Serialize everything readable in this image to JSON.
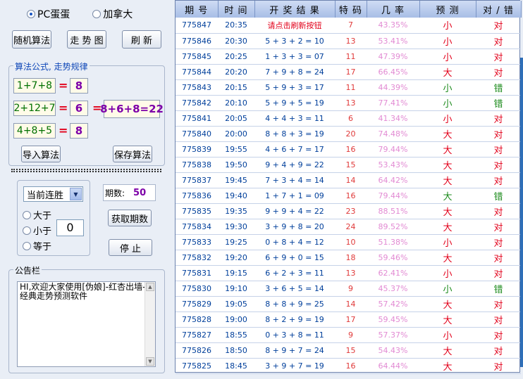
{
  "mode": {
    "options": [
      {
        "label": "PC蛋蛋",
        "selected": true
      },
      {
        "label": "加拿大",
        "selected": false
      }
    ]
  },
  "toolbar": {
    "random_label": "随机算法",
    "trend_label": "走 势 图",
    "refresh_label": "刷 新"
  },
  "formula_group": {
    "title": "算法公式, 走势规律",
    "formulas": [
      {
        "expr": "1+7+8",
        "eq": "=",
        "value": "8"
      },
      {
        "expr": "2+12+7",
        "eq": "=",
        "value": "6"
      },
      {
        "expr": "4+8+5",
        "eq": "=",
        "value": "8"
      }
    ],
    "total_eq": "=",
    "total": "8+6+8=22",
    "import_label": "导入算法",
    "save_label": "保存算法"
  },
  "filter": {
    "select_value": "当前连胜",
    "radios": [
      {
        "label": "大于",
        "selected": false
      },
      {
        "label": "小于",
        "selected": false
      },
      {
        "label": "等于",
        "selected": false
      }
    ],
    "threshold": "0",
    "periods_label": "期数:",
    "periods_value": "50",
    "fetch_label": "获取期数",
    "stop_label": "停 止"
  },
  "notice": {
    "title": "公告栏",
    "text": "HI,欢迎大家使用[伪娘]-红杏出墙-经典走势预测软件"
  },
  "colors": {
    "accent": "#1048b8",
    "red": "#e2001a",
    "green": "#1b8a1b",
    "rate": "#e28ad3"
  },
  "table": {
    "headers": [
      "期 号",
      "时 间",
      "开 奖 结 果",
      "特 码",
      "几 率",
      "预 测",
      "对 / 错"
    ],
    "rows": [
      {
        "id": "775847",
        "time": "20:35",
        "result": "请点击刷新按钮",
        "code": "7",
        "rate": "43.35%",
        "pred": "小",
        "ok": "对"
      },
      {
        "id": "775846",
        "time": "20:30",
        "result": "5 + 3 + 2 = 10",
        "code": "13",
        "rate": "53.41%",
        "pred": "小",
        "ok": "对"
      },
      {
        "id": "775845",
        "time": "20:25",
        "result": "1 + 3 + 3 = 07",
        "code": "11",
        "rate": "47.39%",
        "pred": "小",
        "ok": "对"
      },
      {
        "id": "775844",
        "time": "20:20",
        "result": "7 + 9 + 8 = 24",
        "code": "17",
        "rate": "66.45%",
        "pred": "大",
        "ok": "对"
      },
      {
        "id": "775843",
        "time": "20:15",
        "result": "5 + 9 + 3 = 17",
        "code": "11",
        "rate": "44.39%",
        "pred": "小",
        "ok": "错"
      },
      {
        "id": "775842",
        "time": "20:10",
        "result": "5 + 9 + 5 = 19",
        "code": "13",
        "rate": "77.41%",
        "pred": "小",
        "ok": "错"
      },
      {
        "id": "775841",
        "time": "20:05",
        "result": "4 + 4 + 3 = 11",
        "code": "6",
        "rate": "41.34%",
        "pred": "小",
        "ok": "对"
      },
      {
        "id": "775840",
        "time": "20:00",
        "result": "8 + 8 + 3 = 19",
        "code": "20",
        "rate": "74.48%",
        "pred": "大",
        "ok": "对"
      },
      {
        "id": "775839",
        "time": "19:55",
        "result": "4 + 6 + 7 = 17",
        "code": "16",
        "rate": "79.44%",
        "pred": "大",
        "ok": "对"
      },
      {
        "id": "775838",
        "time": "19:50",
        "result": "9 + 4 + 9 = 22",
        "code": "15",
        "rate": "53.43%",
        "pred": "大",
        "ok": "对"
      },
      {
        "id": "775837",
        "time": "19:45",
        "result": "7 + 3 + 4 = 14",
        "code": "14",
        "rate": "64.42%",
        "pred": "大",
        "ok": "对"
      },
      {
        "id": "775836",
        "time": "19:40",
        "result": "1 + 7 + 1 = 09",
        "code": "16",
        "rate": "79.44%",
        "pred": "大",
        "ok": "错"
      },
      {
        "id": "775835",
        "time": "19:35",
        "result": "9 + 9 + 4 = 22",
        "code": "23",
        "rate": "88.51%",
        "pred": "大",
        "ok": "对"
      },
      {
        "id": "775834",
        "time": "19:30",
        "result": "3 + 9 + 8 = 20",
        "code": "24",
        "rate": "89.52%",
        "pred": "大",
        "ok": "对"
      },
      {
        "id": "775833",
        "time": "19:25",
        "result": "0 + 8 + 4 = 12",
        "code": "10",
        "rate": "51.38%",
        "pred": "小",
        "ok": "对"
      },
      {
        "id": "775832",
        "time": "19:20",
        "result": "6 + 9 + 0 = 15",
        "code": "18",
        "rate": "59.46%",
        "pred": "大",
        "ok": "对"
      },
      {
        "id": "775831",
        "time": "19:15",
        "result": "6 + 2 + 3 = 11",
        "code": "13",
        "rate": "62.41%",
        "pred": "小",
        "ok": "对"
      },
      {
        "id": "775830",
        "time": "19:10",
        "result": "3 + 6 + 5 = 14",
        "code": "9",
        "rate": "45.37%",
        "pred": "小",
        "ok": "错"
      },
      {
        "id": "775829",
        "time": "19:05",
        "result": "8 + 8 + 9 = 25",
        "code": "14",
        "rate": "57.42%",
        "pred": "大",
        "ok": "对"
      },
      {
        "id": "775828",
        "time": "19:00",
        "result": "8 + 2 + 9 = 19",
        "code": "17",
        "rate": "59.45%",
        "pred": "大",
        "ok": "对"
      },
      {
        "id": "775827",
        "time": "18:55",
        "result": "0 + 3 + 8 = 11",
        "code": "9",
        "rate": "57.37%",
        "pred": "小",
        "ok": "对"
      },
      {
        "id": "775826",
        "time": "18:50",
        "result": "8 + 9 + 7 = 24",
        "code": "15",
        "rate": "54.43%",
        "pred": "大",
        "ok": "对"
      },
      {
        "id": "775825",
        "time": "18:45",
        "result": "3 + 9 + 7 = 19",
        "code": "16",
        "rate": "64.44%",
        "pred": "大",
        "ok": "对"
      }
    ]
  }
}
